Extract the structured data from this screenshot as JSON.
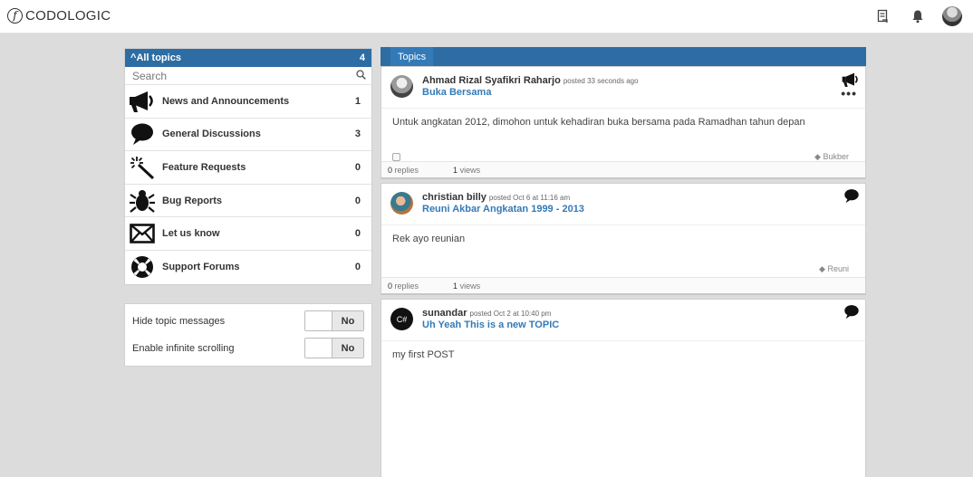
{
  "header": {
    "logo_mark": "f",
    "logo_text": "CODOLOGIC",
    "icons": [
      "compose-icon",
      "bell-icon",
      "user-avatar"
    ]
  },
  "sidebar": {
    "title": "All topics",
    "total": "4",
    "search_placeholder": "Search",
    "categories": [
      {
        "icon": "megaphone-icon",
        "label": "News and Announcements",
        "count": "1"
      },
      {
        "icon": "speech-bubble-icon",
        "label": "General Discussions",
        "count": "3"
      },
      {
        "icon": "magic-wand-icon",
        "label": "Feature Requests",
        "count": "0"
      },
      {
        "icon": "bug-icon",
        "label": "Bug Reports",
        "count": "0"
      },
      {
        "icon": "envelope-icon",
        "label": "Let us know",
        "count": "0"
      },
      {
        "icon": "lifebuoy-icon",
        "label": "Support Forums",
        "count": "0"
      }
    ]
  },
  "settings": {
    "hide_topic_messages": {
      "label": "Hide topic messages",
      "value": "No"
    },
    "infinite_scrolling": {
      "label": "Enable infinite scrolling",
      "value": "No"
    }
  },
  "topics": {
    "tab": "Topics",
    "posts": [
      {
        "author": "Ahmad Rizal Syafikri Raharjo",
        "time": "posted 33 seconds ago",
        "title": "Buka Bersama",
        "body": "Untuk angkatan 2012, dimohon untuk kehadiran buka bersama pada Ramadhan tahun depan",
        "tag": "Bukber",
        "replies": "0",
        "replies_label": "replies",
        "views": "1",
        "views_label": "views",
        "category_icon": "megaphone-icon",
        "more": "•••"
      },
      {
        "author": "christian billy",
        "time": "posted Oct 6 at 11:16 am",
        "title": "Reuni Akbar Angkatan 1999 - 2013",
        "body": "Rek ayo reunian",
        "tag": "Reuni",
        "replies": "0",
        "replies_label": "replies",
        "views": "1",
        "views_label": "views",
        "category_icon": "speech-bubble-icon"
      },
      {
        "author": "sunandar",
        "time": "posted Oct 2 at 10:40 pm",
        "title": "Uh Yeah This is a new TOPIC",
        "body": "my first POST",
        "avatar_text": "C#",
        "category_icon": "speech-bubble-icon"
      }
    ]
  }
}
